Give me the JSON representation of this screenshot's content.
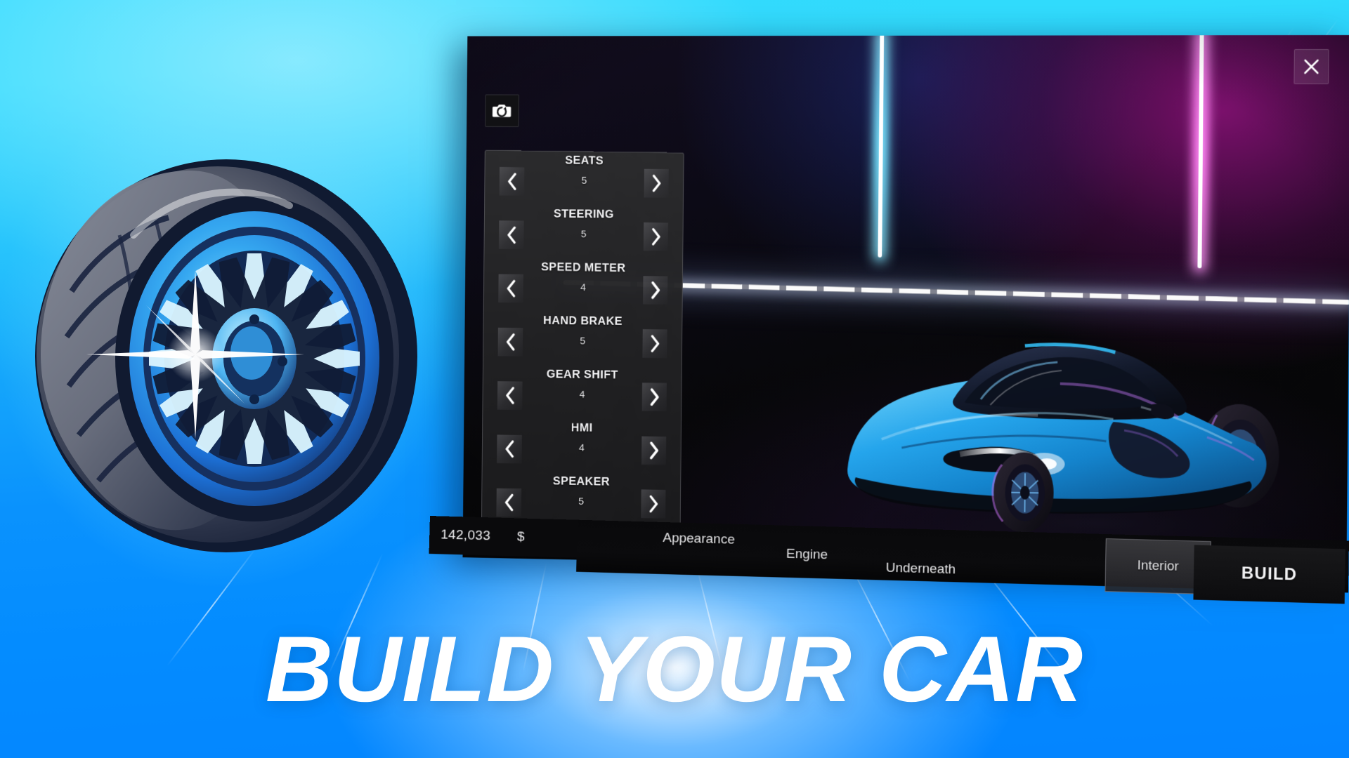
{
  "background": {
    "top_color": "#2edcff",
    "bottom_color": "#0484ff",
    "glow_color": "#ffffff"
  },
  "headline": {
    "text": "BUILD YOUR CAR",
    "color": "#ffffff"
  },
  "wheel_art": {
    "icon": "car-wheel-illustration",
    "tire_dark": "#141d33",
    "tire_tread": "#6b6f7d",
    "rim_blue": "#1e7ce0",
    "rim_light": "#63d2ff",
    "sparkle": "#ffffff"
  },
  "window": {
    "close_label": "✕",
    "close_icon": "close-icon",
    "camera_icon": "camera-rotate-icon",
    "scene": {
      "car": "blue-supercar",
      "car_color": "#1f9ae8",
      "neon_left_color": "#27c8ff",
      "neon_right_color": "#ff27d8",
      "led_strip_color": "#ffffff"
    }
  },
  "options_panel": {
    "left_arrow_icon": "chevron-left-icon",
    "right_arrow_icon": "chevron-right-icon",
    "items": [
      {
        "label": "SEATS",
        "value": "5"
      },
      {
        "label": "STEERING",
        "value": "5"
      },
      {
        "label": "SPEED METER",
        "value": "4"
      },
      {
        "label": "HAND BRAKE",
        "value": "5"
      },
      {
        "label": "GEAR SHIFT",
        "value": "4"
      },
      {
        "label": "HMI",
        "value": "4"
      },
      {
        "label": "SPEAKER",
        "value": "5"
      }
    ]
  },
  "bottom_bar": {
    "money": {
      "amount": "142,033",
      "currency": "$"
    },
    "tabs": [
      {
        "label": "Appearance",
        "active": false
      },
      {
        "label": "Engine",
        "active": false
      },
      {
        "label": "Underneath",
        "active": false
      },
      {
        "label": "Interior",
        "active": true
      }
    ],
    "build_button": {
      "label": "BUILD"
    }
  }
}
